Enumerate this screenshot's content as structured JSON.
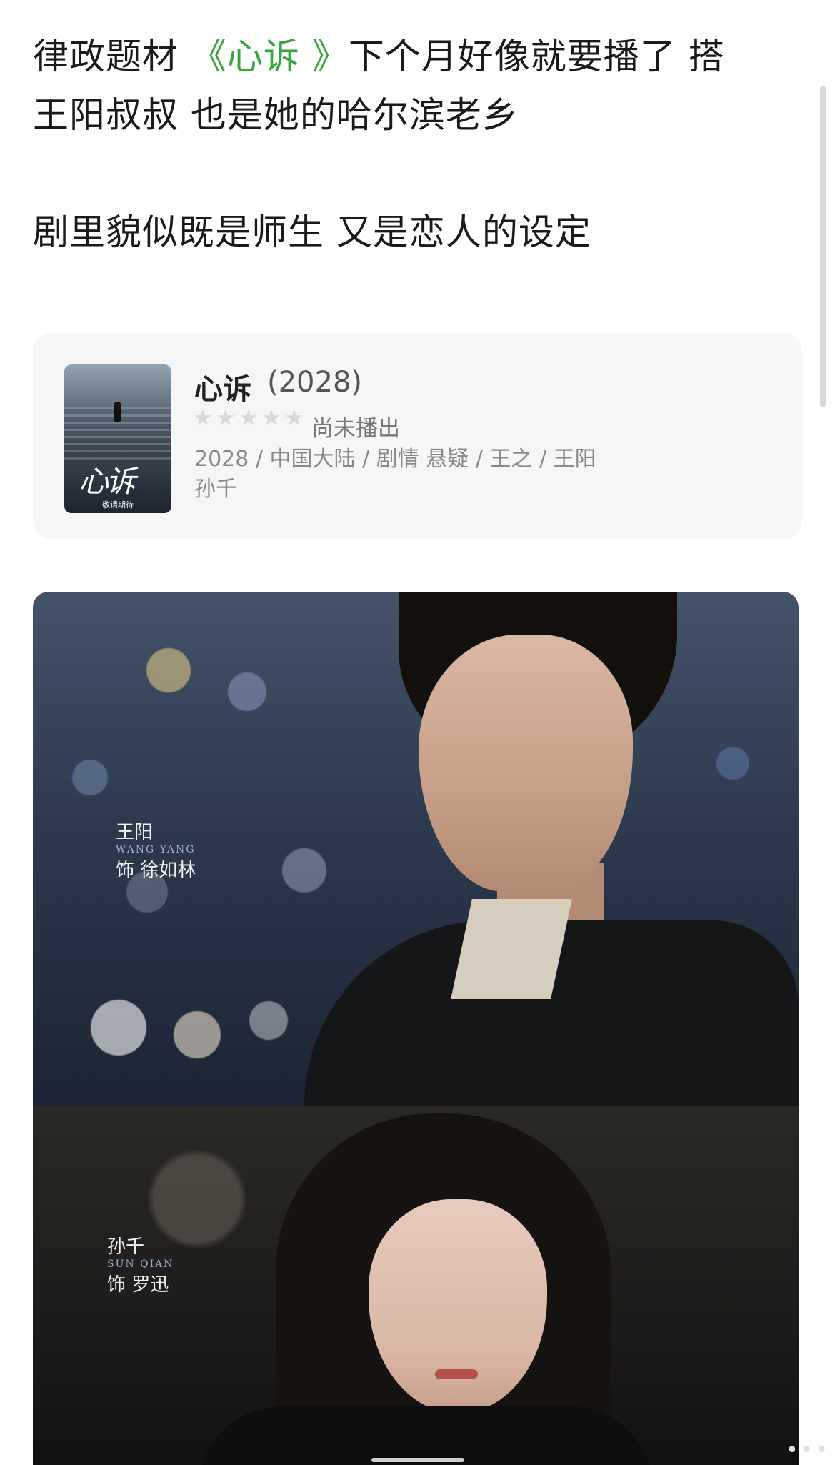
{
  "post": {
    "line1_prefix": "律政题材 ",
    "line1_link": "《心诉 》",
    "line1_suffix": "下个月好像就要播了 搭",
    "line2": "王阳叔叔 也是她的哈尔滨老乡",
    "line3": "剧里貌似既是师生 又是恋人的设定",
    "link_color": "#3aa540"
  },
  "card": {
    "title": "心诉",
    "year": "(2028)",
    "rating_stars": 0,
    "rating_max": 5,
    "status": "尚未播出",
    "meta_line1": "2028 / 中国大陆 / 剧情 悬疑 / 王之 / 王阳",
    "meta_line2": "孙千",
    "poster": {
      "title": "心诉",
      "footer": "敬请期待"
    }
  },
  "photo": {
    "caption1": {
      "name": "王阳",
      "name_en": "WANG YANG",
      "role": "饰 徐如林"
    },
    "caption2": {
      "name": "孙千",
      "name_en": "SUN QIAN",
      "role": "饰 罗迅"
    }
  },
  "icons": {
    "star": "star-icon",
    "more": "more-dots-icon"
  }
}
